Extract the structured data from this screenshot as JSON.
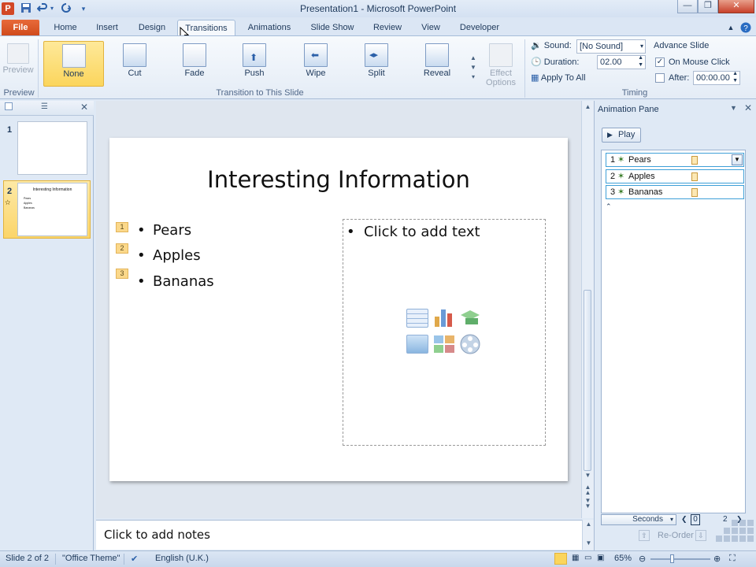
{
  "window": {
    "title": "Presentation1 - Microsoft PowerPoint",
    "controls": [
      "minimize",
      "maximize",
      "close"
    ]
  },
  "quick_access": {
    "icons": [
      "powerpoint-logo-icon",
      "save-icon",
      "undo-icon",
      "undo-dropdown-icon",
      "redo-icon",
      "customize-icon"
    ],
    "logo_letter": "P"
  },
  "tabs": {
    "file": "File",
    "items": [
      "Home",
      "Insert",
      "Design",
      "Transitions",
      "Animations",
      "Slide Show",
      "Review",
      "View",
      "Developer"
    ],
    "active": "Transitions"
  },
  "ribbon": {
    "preview": {
      "label": "Preview",
      "group_label": "Preview"
    },
    "transitions": {
      "group_label": "Transition to This Slide",
      "items": [
        "None",
        "Cut",
        "Fade",
        "Push",
        "Wipe",
        "Split",
        "Reveal"
      ],
      "selected": "None"
    },
    "effect_options": {
      "label_line1": "Effect",
      "label_line2": "Options"
    },
    "timing": {
      "group_label": "Timing",
      "sound_label": "Sound:",
      "sound_value": "[No Sound]",
      "duration_label": "Duration:",
      "duration_value": "02.00",
      "apply_all": "Apply To All",
      "advance_label": "Advance Slide",
      "on_mouse_click": "On Mouse Click",
      "on_mouse_click_checked": true,
      "after_label": "After:",
      "after_value": "00:00.00",
      "after_checked": false
    }
  },
  "slides_panel": {
    "slides": [
      {
        "number": "1"
      },
      {
        "number": "2",
        "title": "Interesting Information",
        "bullets": [
          "Pears",
          "Apples",
          "Bananas"
        ]
      }
    ],
    "selected": 2
  },
  "slide": {
    "title": "Interesting Information",
    "bullets": [
      {
        "tag": "1",
        "text": "Pears"
      },
      {
        "tag": "2",
        "text": "Apples"
      },
      {
        "tag": "3",
        "text": "Bananas"
      }
    ],
    "placeholder_text": "Click to add text",
    "placeholder_icons": [
      "insert-table-icon",
      "insert-chart-icon",
      "insert-smartart-icon",
      "insert-picture-icon",
      "insert-clipart-icon",
      "insert-media-icon"
    ]
  },
  "notes": {
    "placeholder": "Click to add notes"
  },
  "animation_pane": {
    "title": "Animation Pane",
    "play_label": "Play",
    "items": [
      {
        "num": "1",
        "label": "Pears"
      },
      {
        "num": "2",
        "label": "Apples"
      },
      {
        "num": "3",
        "label": "Bananas"
      }
    ],
    "seconds_label": "Seconds",
    "timeline_start": "0",
    "timeline_end": "2",
    "reorder_label": "Re-Order"
  },
  "statusbar": {
    "slide_info": "Slide 2 of 2",
    "theme": "\"Office Theme\"",
    "language": "English (U.K.)",
    "zoom": "65%"
  },
  "colors": {
    "accent_file_tab": "#cf4a1b",
    "selected_transition": "#fbd55c",
    "anim_highlight": "#3fa0d8"
  }
}
